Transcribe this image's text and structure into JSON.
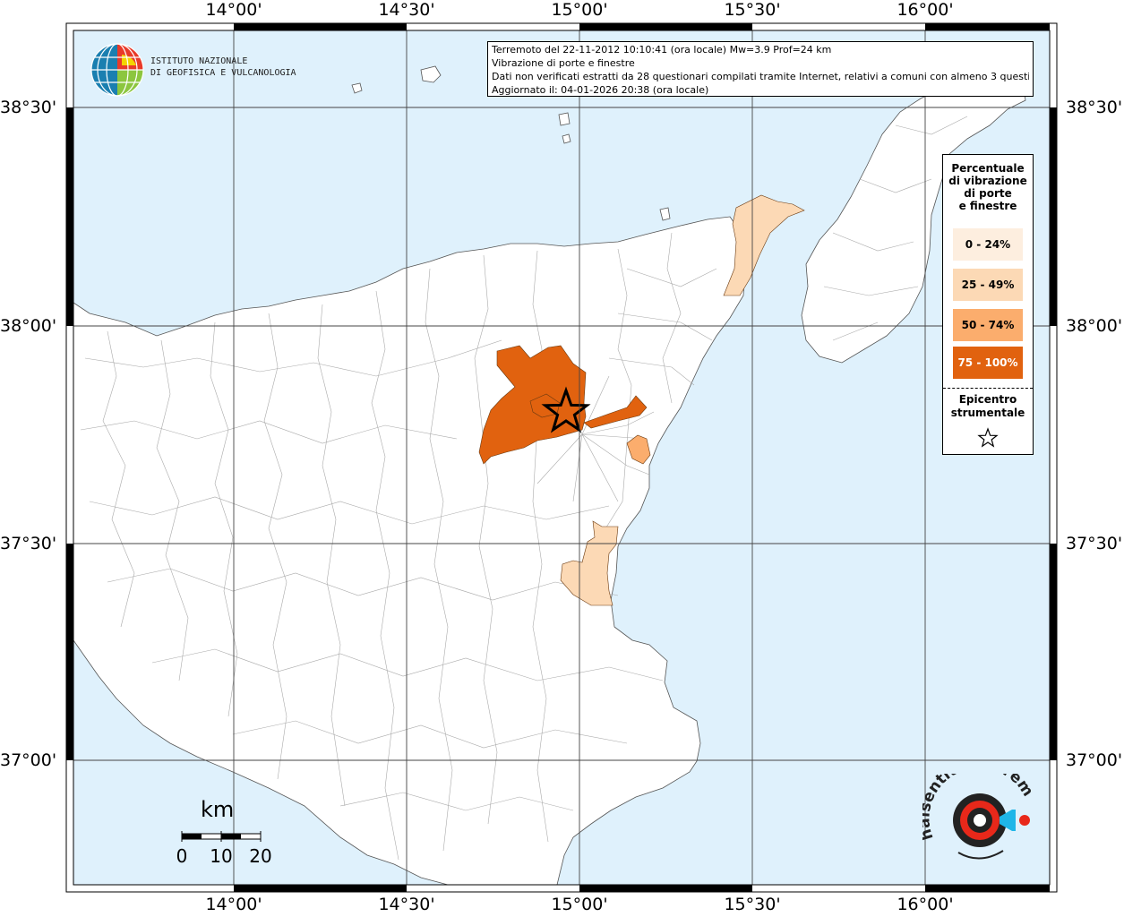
{
  "info": {
    "line1": "Terremoto del 22-11-2012 10:10:41 (ora locale) Mw=3.9 Prof=24 km",
    "line2": "Vibrazione di porte e finestre",
    "line3": "Dati non verificati estratti da 28 questionari compilati tramite Internet, relativi a comuni con almeno 3 questionari.",
    "line4": "Aggiornato il: 04-01-2026 20:38 (ora locale)"
  },
  "axes": {
    "lon_labels": [
      "14°00'",
      "14°30'",
      "15°00'",
      "15°30'",
      "16°00'"
    ],
    "lat_labels": [
      "38°30'",
      "38°00'",
      "37°30'",
      "37°00'"
    ]
  },
  "legend": {
    "title_lines": [
      "Percentuale",
      "di vibrazione",
      "di porte",
      "e finestre"
    ],
    "classes": [
      {
        "label": "0 - 24%",
        "color": "#fdeedf"
      },
      {
        "label": "25 - 49%",
        "color": "#fcd9b5"
      },
      {
        "label": "50 - 74%",
        "color": "#fbad6d"
      },
      {
        "label": "75 - 100%",
        "color": "#e1620f"
      }
    ],
    "epicenter_lines": [
      "Epicentro",
      "strumentale"
    ]
  },
  "logo": {
    "line1": "ISTITUTO NAZIONALE",
    "line2": "DI GEOFISICA E VULCANOLOGIA"
  },
  "scale": {
    "unit": "km",
    "ticks": [
      "0",
      "10",
      "20"
    ]
  },
  "colors": {
    "sea": "#dff1fc",
    "land": "#ffffff"
  }
}
